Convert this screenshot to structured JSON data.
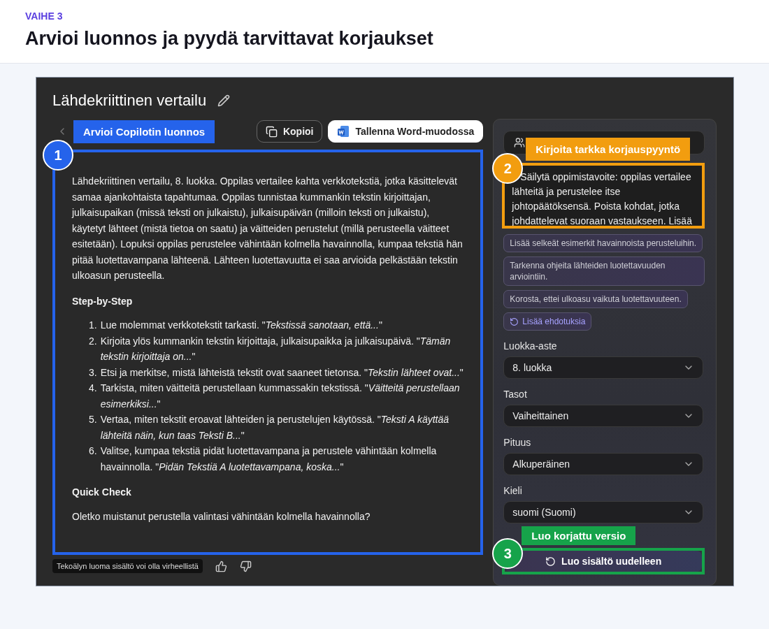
{
  "header": {
    "step": "VAIHE 3",
    "title": "Arvioi luonnos ja pyydä tarvittavat korjaukset"
  },
  "app": {
    "title": "Lähdekriittinen vertailu",
    "actions": [
      {
        "kind": "copy",
        "label": "Kopioi"
      },
      {
        "kind": "word",
        "label": "Tallenna Word-muodossa"
      }
    ],
    "draft": {
      "intro": "Lähdekriittinen vertailu, 8. luokka. Oppilas vertailee kahta verkkotekstiä, jotka käsittelevät samaa ajankohtaista tapahtumaa. Oppilas tunnistaa kummankin tekstin kirjoittajan, julkaisupaikan (missä teksti on julkaistu), julkaisupäivän (milloin teksti on julkaistu), käytetyt lähteet (mistä tietoa on saatu) ja väitteiden perustelut (millä perusteella väitteet esitetään). Lopuksi oppilas perustelee vähintään kolmella havainnolla, kumpaa tekstiä hän pitää luotettavampana lähteenä. Lähteen luotettavuutta ei saa arvioida pelkästään tekstin ulkoasun perusteella.",
      "steps_heading": "Step-by-Step",
      "steps": [
        {
          "number": "1.",
          "text": "Lue molemmat verkkotekstit tarkasti. \"*Tekstissä sanotaan, että...*\""
        },
        {
          "number": "2.",
          "text": "Kirjoita ylös kummankin tekstin kirjoittaja, julkaisupaikka ja julkaisupäivä. \"*Tämän tekstin kirjoittaja on...*\""
        },
        {
          "number": "3.",
          "text": "Etsi ja merkitse, mistä lähteistä tekstit ovat saaneet tietonsa. \"*Tekstin lähteet ovat...*\""
        },
        {
          "number": "4.",
          "text": "Tarkista, miten väitteitä perustellaan kummassakin tekstissä. \"*Väitteitä perustellaan esimerkiksi...*\""
        },
        {
          "number": "5.",
          "text": "Vertaa, miten tekstit eroavat lähteiden ja perustelujen käytössä. \"*Teksti A käyttää lähteitä näin, kun taas Teksti B...*\""
        },
        {
          "number": "6.",
          "text": "Valitse, kumpaa tekstiä pidät luotettavampana ja perustele vähintään kolmella havainnolla. \"*Pidän Tekstiä A luotettavampana, koska...*\""
        }
      ],
      "check_heading": "Quick Check",
      "check_text": "Oletko muistanut perustella valintasi vähintään kolmella havainnolla?"
    },
    "disclaimer": "Tekoälyn luoma sisältö voi olla virheellistä",
    "panel": {
      "prompt": "Säilytä oppimistavoite: oppilas vertailee lähteitä ja perustelee itse johtopäätöksensä. Poista kohdat, jotka johdattelevat suoraan vastaukseen. Lisää",
      "suggestions": [
        "Lisää selkeät esimerkit havainnoista perusteluihin.",
        "Tarkenna ohjeita lähteiden luotettavuuden arviointiin.",
        "Korosta, ettei ulkoasu vaikuta luotettavuuteen."
      ],
      "more": "Lisää ehdotuksia",
      "fields": [
        {
          "label": "Luokka-aste",
          "value": "8. luokka"
        },
        {
          "label": "Tasot",
          "value": "Vaiheittainen"
        },
        {
          "label": "Pituus",
          "value": "Alkuperäinen"
        },
        {
          "label": "Kieli",
          "value": "suomi (Suomi)"
        }
      ],
      "regenerate": "Luo sisältö uudelleen"
    }
  },
  "callouts": [
    {
      "number": "1",
      "label": "Arvioi Copilotin luonnos",
      "color": "#2563eb"
    },
    {
      "number": "2",
      "label": "Kirjoita tarkka korjauspyyntö",
      "color": "#f29d0f"
    },
    {
      "number": "3",
      "label": "Luo korjattu versio",
      "color": "#16a34a"
    }
  ]
}
